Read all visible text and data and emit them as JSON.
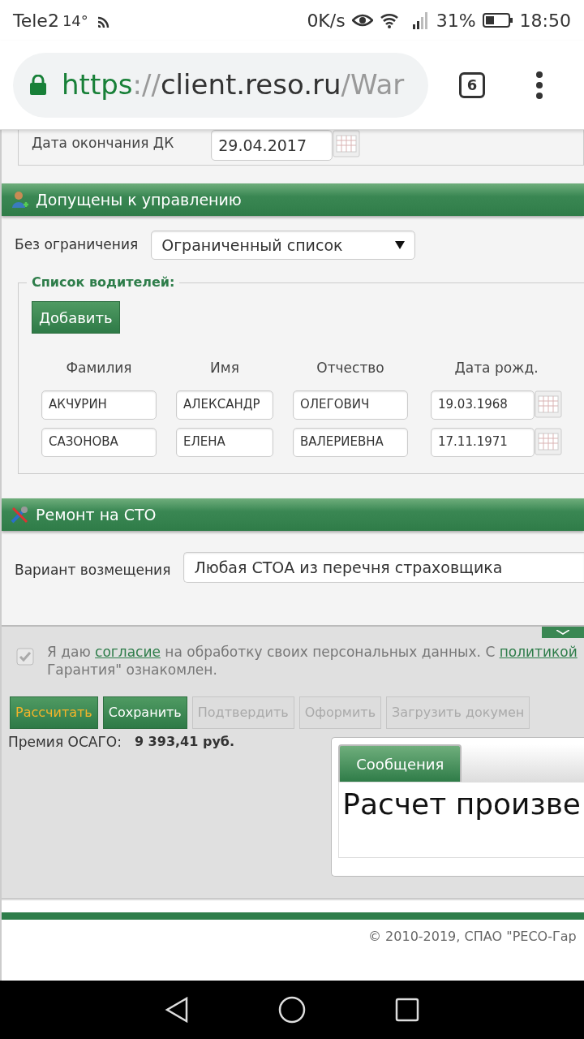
{
  "status_bar": {
    "carrier": "Tele2",
    "temperature": "14°",
    "speed": "0K/s",
    "battery": "31%",
    "time": "18:50"
  },
  "browser": {
    "url_scheme": "https",
    "url_sep": "://",
    "url_host": "client.reso.ru",
    "url_path": "/War",
    "tab_count": "6"
  },
  "top_fieldset": {
    "label": "Дата окончания ДК",
    "value": "29.04.2017"
  },
  "drivers_section": {
    "title": "Допущены к управлению",
    "restriction_label": "Без ограничения",
    "restriction_value": "Ограниченный список",
    "list_legend": "Список водителей:",
    "add_button": "Добавить",
    "columns": [
      "Фамилия",
      "Имя",
      "Отчество",
      "Дата рожд."
    ],
    "rows": [
      [
        "АКЧУРИН",
        "АЛЕКСАНДР",
        "ОЛЕГОВИЧ",
        "19.03.1968"
      ],
      [
        "САЗОНОВА",
        "ЕЛЕНА",
        "ВАЛЕРИЕВНА",
        "17.11.1971"
      ]
    ]
  },
  "repair_section": {
    "title": "Ремонт на СТО",
    "option_label": "Вариант возмещения",
    "option_value": "Любая СТОА из перечня страховщика"
  },
  "bottom_panel": {
    "consent": {
      "checked": true,
      "disabled": true,
      "parts": [
        {
          "text": "Я даю ",
          "kind": "text"
        },
        {
          "text": "согласие",
          "kind": "link"
        },
        {
          "text": " на обработку своих персональных данных. С ",
          "kind": "text"
        },
        {
          "text": "политикой",
          "kind": "link"
        }
      ],
      "line2": "Гарантия\" ознакомлен."
    },
    "buttons": [
      {
        "label": "Рассчитать",
        "kind": "primary",
        "disabled": false
      },
      {
        "label": "Сохранить",
        "kind": "normal",
        "disabled": false
      },
      {
        "label": "Подтвердить",
        "kind": "normal",
        "disabled": true
      },
      {
        "label": "Оформить",
        "kind": "normal",
        "disabled": true
      },
      {
        "label": "Загрузить докумен",
        "kind": "normal",
        "disabled": true
      }
    ],
    "premium_label": "Премия ОСАГО:",
    "premium_value": "9 393,41 руб.",
    "messages_tab": "Сообщения",
    "message": "Расчет произве"
  },
  "footer": {
    "copyright": "© 2010-2019, СПАО \"РЕСО-Гар"
  }
}
